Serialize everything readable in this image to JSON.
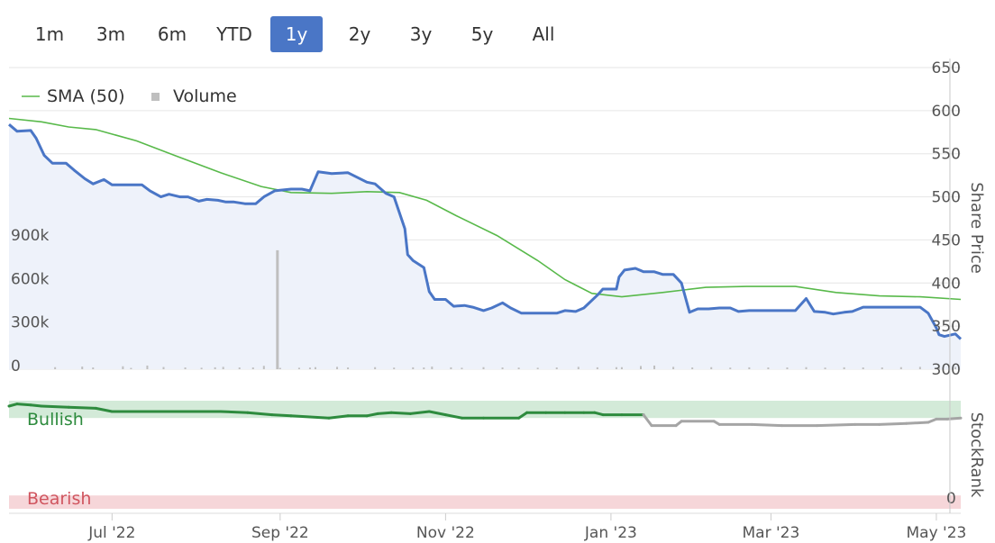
{
  "range_selector": {
    "buttons": [
      {
        "label": "1m"
      },
      {
        "label": "3m"
      },
      {
        "label": "6m"
      },
      {
        "label": "YTD"
      },
      {
        "label": "1y",
        "active": true
      },
      {
        "label": "2y"
      },
      {
        "label": "3y"
      },
      {
        "label": "5y"
      },
      {
        "label": "All"
      }
    ]
  },
  "colors": {
    "price": "#4a76c6",
    "sma": "#58b94a",
    "volume": "#bfbfbf",
    "stockrank_bull": "#2e8b3e",
    "stockrank_other": "#a5a5a5",
    "bullish_band": "#d3ead8",
    "bearish_band": "#f6d6d9",
    "bullish_text": "#2e8b3e",
    "bearish_text": "#d0555f",
    "grid": "#e6e6e6",
    "price_fill": "#eef2fa"
  },
  "chart_data": [
    {
      "type": "line",
      "title": "",
      "xlabel": "",
      "x_ticks": [
        "Jul '22",
        "Sep '22",
        "Nov '22",
        "Jan '23",
        "Mar '23",
        "May '23"
      ],
      "x_range": [
        "2022-05-24",
        "2023-05-10"
      ],
      "ylabel_right": "Share Price",
      "y_right_ticks": [
        650,
        600,
        550,
        500,
        450,
        400,
        350,
        300
      ],
      "y_right_range": [
        300,
        650
      ],
      "y_left_ticks": [
        "900k",
        "600k",
        "300k",
        "0"
      ],
      "y_left_values": [
        900000,
        600000,
        300000,
        0
      ],
      "grid": true,
      "legend": {
        "position": "top-left",
        "items": [
          "SMA (50)",
          "Volume"
        ]
      },
      "series": [
        {
          "name": "Share Price",
          "style": "line-with-fill",
          "points": [
            [
              "2022-05-24",
              584
            ],
            [
              "2022-05-27",
              576
            ],
            [
              "2022-06-01",
              577
            ],
            [
              "2022-06-03",
              568
            ],
            [
              "2022-06-06",
              548
            ],
            [
              "2022-06-09",
              539
            ],
            [
              "2022-06-14",
              539
            ],
            [
              "2022-06-17",
              531
            ],
            [
              "2022-06-21",
              521
            ],
            [
              "2022-06-24",
              515
            ],
            [
              "2022-06-28",
              520
            ],
            [
              "2022-07-01",
              514
            ],
            [
              "2022-07-06",
              514
            ],
            [
              "2022-07-12",
              514
            ],
            [
              "2022-07-15",
              507
            ],
            [
              "2022-07-19",
              500
            ],
            [
              "2022-07-22",
              503
            ],
            [
              "2022-07-26",
              500
            ],
            [
              "2022-07-29",
              500
            ],
            [
              "2022-08-02",
              495
            ],
            [
              "2022-08-05",
              497
            ],
            [
              "2022-08-09",
              496
            ],
            [
              "2022-08-12",
              494
            ],
            [
              "2022-08-15",
              494
            ],
            [
              "2022-08-19",
              492
            ],
            [
              "2022-08-23",
              492
            ],
            [
              "2022-08-26",
              500
            ],
            [
              "2022-08-30",
              507
            ],
            [
              "2022-09-05",
              509
            ],
            [
              "2022-09-09",
              509
            ],
            [
              "2022-09-12",
              507
            ],
            [
              "2022-09-15",
              529
            ],
            [
              "2022-09-20",
              527
            ],
            [
              "2022-09-26",
              528
            ],
            [
              "2022-10-03",
              517
            ],
            [
              "2022-10-06",
              515
            ],
            [
              "2022-10-10",
              504
            ],
            [
              "2022-10-13",
              500
            ],
            [
              "2022-10-17",
              463
            ],
            [
              "2022-10-18",
              433
            ],
            [
              "2022-10-20",
              426
            ],
            [
              "2022-10-24",
              418
            ],
            [
              "2022-10-26",
              390
            ],
            [
              "2022-10-28",
              381
            ],
            [
              "2022-11-01",
              381
            ],
            [
              "2022-11-04",
              373
            ],
            [
              "2022-11-08",
              374
            ],
            [
              "2022-11-11",
              372
            ],
            [
              "2022-11-15",
              368
            ],
            [
              "2022-11-18",
              371
            ],
            [
              "2022-11-22",
              377
            ],
            [
              "2022-11-25",
              371
            ],
            [
              "2022-11-29",
              365
            ],
            [
              "2022-12-02",
              365
            ],
            [
              "2022-12-07",
              365
            ],
            [
              "2022-12-12",
              365
            ],
            [
              "2022-12-15",
              368
            ],
            [
              "2022-12-19",
              367
            ],
            [
              "2022-12-22",
              371
            ],
            [
              "2022-12-27",
              386
            ],
            [
              "2022-12-29",
              393
            ],
            [
              "2023-01-03",
              393
            ],
            [
              "2023-01-04",
              407
            ],
            [
              "2023-01-06",
              415
            ],
            [
              "2023-01-10",
              417
            ],
            [
              "2023-01-13",
              413
            ],
            [
              "2023-01-17",
              413
            ],
            [
              "2023-01-20",
              410
            ],
            [
              "2023-01-24",
              410
            ],
            [
              "2023-01-27",
              400
            ],
            [
              "2023-01-30",
              366
            ],
            [
              "2023-02-02",
              370
            ],
            [
              "2023-02-06",
              370
            ],
            [
              "2023-02-10",
              371
            ],
            [
              "2023-02-14",
              371
            ],
            [
              "2023-02-17",
              367
            ],
            [
              "2023-02-21",
              368
            ],
            [
              "2023-02-24",
              368
            ],
            [
              "2023-03-01",
              368
            ],
            [
              "2023-03-06",
              368
            ],
            [
              "2023-03-10",
              368
            ],
            [
              "2023-03-14",
              382
            ],
            [
              "2023-03-17",
              367
            ],
            [
              "2023-03-21",
              366
            ],
            [
              "2023-03-24",
              364
            ],
            [
              "2023-03-28",
              366
            ],
            [
              "2023-03-31",
              367
            ],
            [
              "2023-04-04",
              372
            ],
            [
              "2023-04-07",
              372
            ],
            [
              "2023-04-12",
              372
            ],
            [
              "2023-04-17",
              372
            ],
            [
              "2023-04-21",
              372
            ],
            [
              "2023-04-25",
              372
            ],
            [
              "2023-04-28",
              365
            ],
            [
              "2023-05-01",
              348
            ],
            [
              "2023-05-02",
              340
            ],
            [
              "2023-05-04",
              338
            ],
            [
              "2023-05-08",
              341
            ],
            [
              "2023-05-10",
              335
            ]
          ]
        },
        {
          "name": "SMA (50)",
          "style": "line",
          "points": [
            [
              "2022-05-24",
              591
            ],
            [
              "2022-06-05",
              587
            ],
            [
              "2022-06-15",
              581
            ],
            [
              "2022-06-25",
              578
            ],
            [
              "2022-07-10",
              565
            ],
            [
              "2022-07-25",
              547
            ],
            [
              "2022-08-10",
              528
            ],
            [
              "2022-08-25",
              512
            ],
            [
              "2022-09-05",
              505
            ],
            [
              "2022-09-20",
              504
            ],
            [
              "2022-10-03",
              506
            ],
            [
              "2022-10-15",
              505
            ],
            [
              "2022-10-25",
              496
            ],
            [
              "2022-11-05",
              478
            ],
            [
              "2022-11-20",
              455
            ],
            [
              "2022-12-05",
              426
            ],
            [
              "2022-12-15",
              404
            ],
            [
              "2022-12-25",
              388
            ],
            [
              "2023-01-05",
              384
            ],
            [
              "2023-01-20",
              389
            ],
            [
              "2023-02-05",
              395
            ],
            [
              "2023-02-20",
              396
            ],
            [
              "2023-03-10",
              396
            ],
            [
              "2023-03-25",
              389
            ],
            [
              "2023-04-10",
              385
            ],
            [
              "2023-04-25",
              384
            ],
            [
              "2023-05-10",
              381
            ]
          ]
        }
      ],
      "volume": {
        "name": "Volume",
        "bars": [
          [
            "2022-06-10",
            14000
          ],
          [
            "2022-06-20",
            18000
          ],
          [
            "2022-06-24",
            12000
          ],
          [
            "2022-07-05",
            20000
          ],
          [
            "2022-07-08",
            9000
          ],
          [
            "2022-07-14",
            25000
          ],
          [
            "2022-07-20",
            15000
          ],
          [
            "2022-07-28",
            12000
          ],
          [
            "2022-08-03",
            10000
          ],
          [
            "2022-08-08",
            13000
          ],
          [
            "2022-08-11",
            16000
          ],
          [
            "2022-08-17",
            12000
          ],
          [
            "2022-08-22",
            12000
          ],
          [
            "2022-08-26",
            23000
          ],
          [
            "2022-09-01",
            9000
          ],
          [
            "2022-09-08",
            10000
          ],
          [
            "2022-09-12",
            11000
          ],
          [
            "2022-09-14",
            14000
          ],
          [
            "2022-09-22",
            16000
          ],
          [
            "2022-09-26",
            12000
          ],
          [
            "2022-10-06",
            14000
          ],
          [
            "2022-10-13",
            11000
          ],
          [
            "2022-10-20",
            13000
          ],
          [
            "2022-10-24",
            12000
          ],
          [
            "2022-10-27",
            18000
          ],
          [
            "2022-11-03",
            13000
          ],
          [
            "2022-11-07",
            10000
          ],
          [
            "2022-11-15",
            14000
          ],
          [
            "2022-11-22",
            12000
          ],
          [
            "2022-11-28",
            11000
          ],
          [
            "2022-12-05",
            10000
          ],
          [
            "2022-12-12",
            12000
          ],
          [
            "2022-12-20",
            16000
          ],
          [
            "2022-12-27",
            13000
          ],
          [
            "2023-01-03",
            14000
          ],
          [
            "2023-01-05",
            14000
          ],
          [
            "2023-01-12",
            22000
          ],
          [
            "2023-01-17",
            25000
          ],
          [
            "2023-01-24",
            16000
          ],
          [
            "2023-01-31",
            12000
          ],
          [
            "2023-02-07",
            14000
          ],
          [
            "2023-02-14",
            11000
          ],
          [
            "2023-02-21",
            13000
          ],
          [
            "2023-02-28",
            12000
          ],
          [
            "2023-03-07",
            12000
          ],
          [
            "2023-03-14",
            14000
          ],
          [
            "2023-03-21",
            11000
          ],
          [
            "2023-03-28",
            13000
          ],
          [
            "2023-04-04",
            12000
          ],
          [
            "2023-04-11",
            12000
          ],
          [
            "2023-04-18",
            14000
          ],
          [
            "2023-04-25",
            16000
          ],
          [
            "2023-05-02",
            18000
          ],
          [
            "2023-05-08",
            15000
          ]
        ]
      }
    },
    {
      "type": "line",
      "title": "",
      "ylabel_right": "StockRank",
      "y_right_ticks": [
        0
      ],
      "y_range": [
        0,
        100
      ],
      "bands": [
        {
          "label": "Bullish",
          "from": 84,
          "to": 100
        },
        {
          "label": "Bearish",
          "from": 0,
          "to": 14
        }
      ],
      "series": [
        {
          "name": "StockRank",
          "points": [
            [
              "2022-05-24",
              95
            ],
            [
              "2022-05-27",
              97
            ],
            [
              "2022-06-01",
              96
            ],
            [
              "2022-06-05",
              95
            ],
            [
              "2022-06-15",
              94
            ],
            [
              "2022-06-25",
              93
            ],
            [
              "2022-07-01",
              90
            ],
            [
              "2022-07-10",
              90
            ],
            [
              "2022-07-20",
              90
            ],
            [
              "2022-08-01",
              90
            ],
            [
              "2022-08-10",
              90
            ],
            [
              "2022-08-20",
              89
            ],
            [
              "2022-08-29",
              87
            ],
            [
              "2022-09-05",
              86
            ],
            [
              "2022-09-12",
              85
            ],
            [
              "2022-09-19",
              84
            ],
            [
              "2022-09-26",
              86
            ],
            [
              "2022-10-03",
              86
            ],
            [
              "2022-10-07",
              88
            ],
            [
              "2022-10-12",
              89
            ],
            [
              "2022-10-19",
              88
            ],
            [
              "2022-10-26",
              90
            ],
            [
              "2022-11-01",
              87
            ],
            [
              "2022-11-07",
              84
            ],
            [
              "2022-11-15",
              84
            ],
            [
              "2022-11-28",
              84
            ],
            [
              "2022-12-01",
              89
            ],
            [
              "2022-12-08",
              89
            ],
            [
              "2022-12-15",
              89
            ],
            [
              "2022-12-22",
              89
            ],
            [
              "2022-12-26",
              89
            ],
            [
              "2022-12-29",
              87
            ],
            [
              "2023-01-05",
              87
            ],
            [
              "2023-01-13",
              87
            ],
            [
              "2023-01-16",
              77
            ],
            [
              "2023-01-25",
              77
            ],
            [
              "2023-01-27",
              81
            ],
            [
              "2023-02-08",
              81
            ],
            [
              "2023-02-10",
              78
            ],
            [
              "2023-02-22",
              78
            ],
            [
              "2023-03-05",
              77
            ],
            [
              "2023-03-18",
              77
            ],
            [
              "2023-04-01",
              78
            ],
            [
              "2023-04-10",
              78
            ],
            [
              "2023-04-20",
              79
            ],
            [
              "2023-04-28",
              80
            ],
            [
              "2023-05-01",
              83
            ],
            [
              "2023-05-05",
              83
            ],
            [
              "2023-05-10",
              84
            ]
          ]
        }
      ]
    }
  ],
  "labels": {
    "legend_sma": "SMA (50)",
    "legend_volume": "Volume",
    "share_price_axis": "Share Price",
    "stockrank_axis": "StockRank",
    "bullish": "Bullish",
    "bearish": "Bearish",
    "stockrank_zero": "0"
  }
}
